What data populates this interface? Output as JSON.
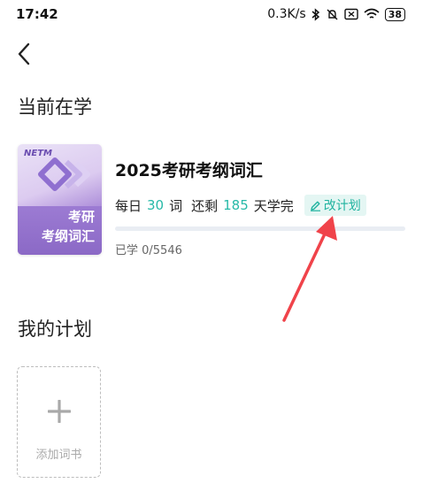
{
  "status_bar": {
    "time": "17:42",
    "network_speed": "0.3K/s",
    "battery_level": "38",
    "icons": [
      "bluetooth-icon",
      "mute-icon",
      "sim-icon",
      "wifi-icon",
      "battery-icon"
    ]
  },
  "nav": {
    "back_icon": "chevron-left-icon"
  },
  "current_section": {
    "title": "当前在学",
    "book": {
      "cover_brand": "NETM",
      "cover_title_line1": "考研",
      "cover_title_line2": "考纲词汇",
      "title": "2025考研考纲词汇",
      "daily_prefix": "每日",
      "daily_count": "30",
      "daily_unit": "词",
      "remaining_prefix": "还剩",
      "remaining_days": "185",
      "remaining_suffix": "天学完",
      "edit_label": "改计划",
      "progress_text": "已学 0/5546",
      "progress_fraction": 0
    }
  },
  "plans_section": {
    "title": "我的计划",
    "add_label": "添加词书"
  },
  "colors": {
    "accent": "#27b9a8",
    "annotation_arrow": "#f0434a",
    "cover_purple": "#8e6bc9"
  }
}
